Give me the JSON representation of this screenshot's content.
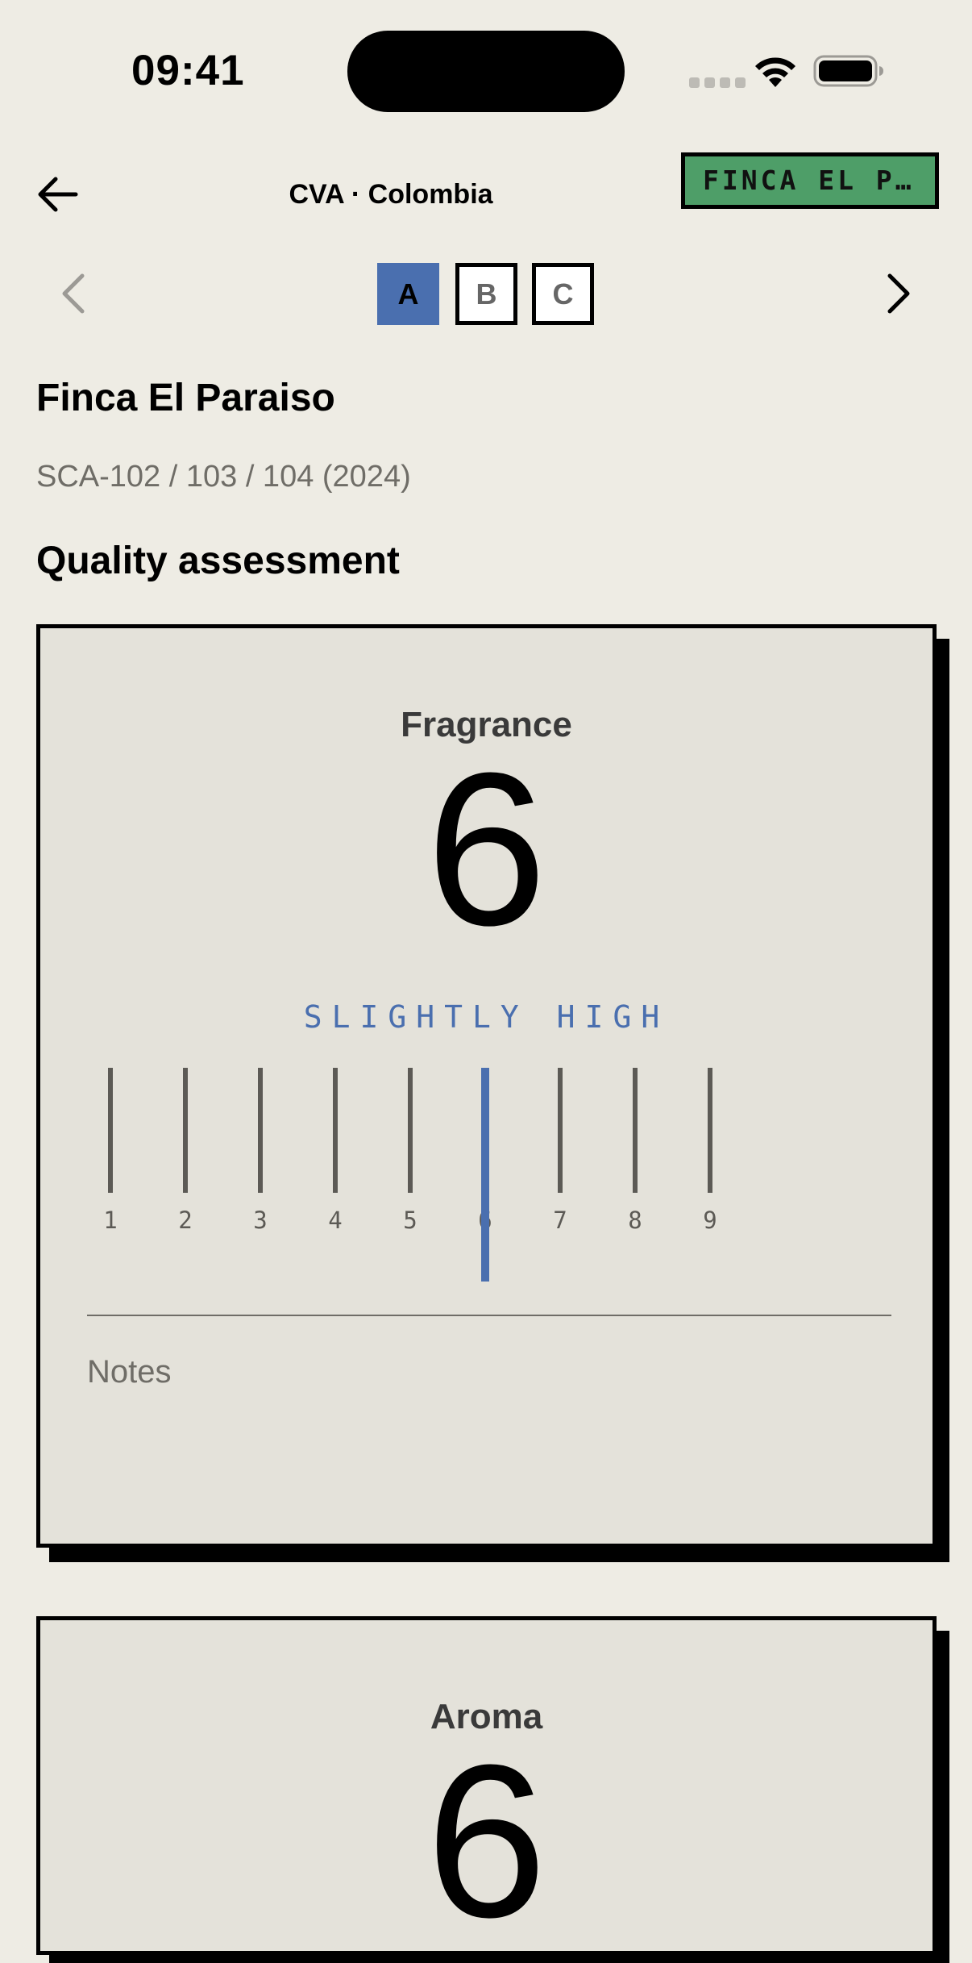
{
  "status_bar": {
    "time": "09:41"
  },
  "header": {
    "title": "CVA · Colombia",
    "farm_chip": "FINCA EL PA…"
  },
  "samples": {
    "tabs": [
      "A",
      "B",
      "C"
    ],
    "active": "A"
  },
  "lot": {
    "name": "Finca El Paraiso",
    "codes": "SCA-102 / 103 / 104 (2024)"
  },
  "section_title": "Quality assessment",
  "assessments": [
    {
      "attribute": "Fragrance",
      "score": "6",
      "intensity": "SLIGHTLY HIGH",
      "scale": [
        "1",
        "2",
        "3",
        "4",
        "5",
        "6",
        "7",
        "8",
        "9"
      ],
      "selected": 6,
      "notes_placeholder": "Notes"
    },
    {
      "attribute": "Aroma",
      "score": "6"
    }
  ],
  "colors": {
    "background": "#EEECE4",
    "card": "#E4E2DA",
    "accent_blue": "#4A6FAF",
    "chip_green": "#4E9E68"
  },
  "icons": {
    "back": "arrow-left-icon",
    "prev": "chevron-left-icon",
    "next": "chevron-right-icon",
    "wifi": "wifi-icon",
    "battery": "battery-icon"
  }
}
